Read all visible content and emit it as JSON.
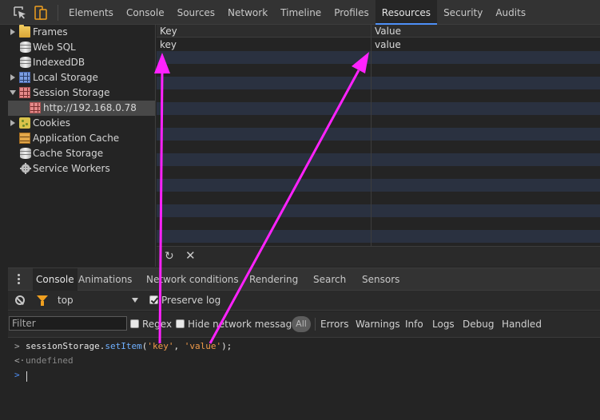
{
  "toolbar": {
    "tabs": [
      "Elements",
      "Console",
      "Sources",
      "Network",
      "Timeline",
      "Profiles",
      "Resources",
      "Security",
      "Audits"
    ],
    "active_tab": "Resources"
  },
  "sidebar": {
    "items": [
      {
        "label": "Frames",
        "icon": "folder-icon"
      },
      {
        "label": "Web SQL",
        "icon": "database-icon"
      },
      {
        "label": "IndexedDB",
        "icon": "database-icon"
      },
      {
        "label": "Local Storage",
        "icon": "local-storage-icon"
      },
      {
        "label": "Session Storage",
        "icon": "session-storage-icon"
      },
      {
        "label": "http://192.168.0.78",
        "icon": "session-storage-icon"
      },
      {
        "label": "Cookies",
        "icon": "cookie-icon"
      },
      {
        "label": "Application Cache",
        "icon": "app-cache-icon"
      },
      {
        "label": "Cache Storage",
        "icon": "database-icon"
      },
      {
        "label": "Service Workers",
        "icon": "gear-icon"
      }
    ],
    "selected": "http://192.168.0.78"
  },
  "storage_grid": {
    "columns": [
      "Key",
      "Value"
    ],
    "rows": [
      {
        "key": "key",
        "value": "value"
      }
    ]
  },
  "grid_toolbar": {
    "refresh_glyph": "↻",
    "clear_glyph": "✕"
  },
  "drawer": {
    "tabs": [
      "Console",
      "Animations",
      "Network conditions",
      "Rendering",
      "Search",
      "Sensors"
    ],
    "active_tab": "Console"
  },
  "console_toolbar": {
    "context": "top",
    "preserve_log_label": "Preserve log",
    "preserve_log_checked": true
  },
  "filter_bar": {
    "placeholder": "Filter",
    "regex_label": "Regex",
    "hide_network_label": "Hide network messages",
    "all_label": "All",
    "levels": [
      "Errors",
      "Warnings",
      "Info",
      "Logs",
      "Debug",
      "Handled"
    ]
  },
  "console": {
    "input_prompt": ">",
    "result_prompt": "<·",
    "code": {
      "object": "sessionStorage",
      "dot": ".",
      "method": "setItem",
      "open": "(",
      "arg1": "'key'",
      "comma": ", ",
      "arg2": "'value'",
      "close": ");"
    },
    "result": "undefined"
  },
  "annotation": {
    "arrow_color": "#ff22ff"
  }
}
